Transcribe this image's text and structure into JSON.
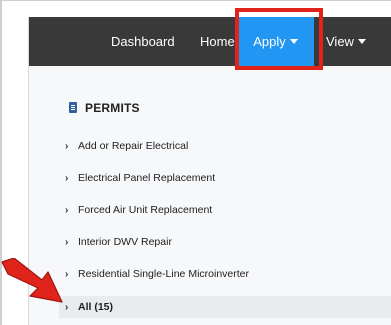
{
  "nav": {
    "items": [
      {
        "label": "Dashboard"
      },
      {
        "label": "Home"
      },
      {
        "label": "Apply",
        "active": true
      },
      {
        "label": "View"
      }
    ],
    "active_color": "#2196f3",
    "background": "#393939"
  },
  "section": {
    "title": "PERMITS",
    "icon": "permit-document-icon"
  },
  "permits": [
    {
      "label": "Add or Repair Electrical"
    },
    {
      "label": "Electrical Panel Replacement"
    },
    {
      "label": "Forced Air Unit Replacement"
    },
    {
      "label": "Interior DWV Repair"
    },
    {
      "label": "Residential Single-Line Microinverter"
    },
    {
      "label": "All (15)",
      "active": true
    }
  ],
  "annotation": {
    "highlight_color": "#e0241c",
    "arrow_color": "#e0241c"
  }
}
